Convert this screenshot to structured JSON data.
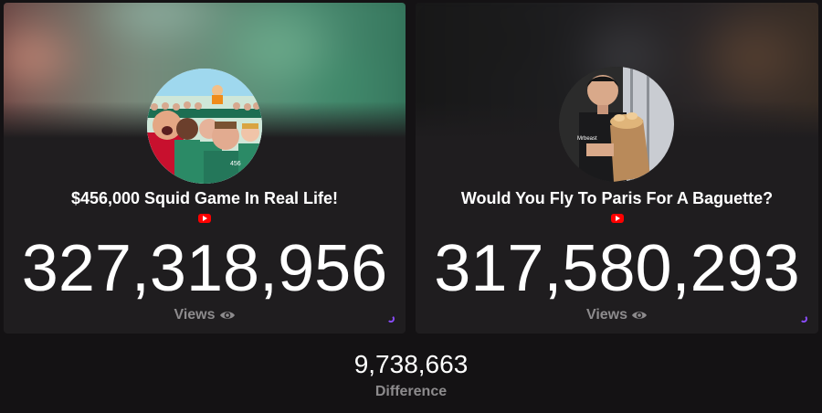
{
  "left": {
    "title": "$456,000 Squid Game In Real Life!",
    "count": "327,318,956",
    "views_label": "Views",
    "platform_icon": "youtube-icon"
  },
  "right": {
    "title": "Would You Fly To Paris For A Baguette?",
    "count": "317,580,293",
    "views_label": "Views",
    "platform_icon": "youtube-icon",
    "thumbnail_watermark": "Mrbeast"
  },
  "difference": {
    "value": "9,738,663",
    "label": "Difference"
  },
  "colors": {
    "background": "#141214",
    "card": "#1f1d1f",
    "label_gray": "#8d8b8d",
    "youtube_red": "#ff0000",
    "spinner_purple": "#8a4cff"
  }
}
